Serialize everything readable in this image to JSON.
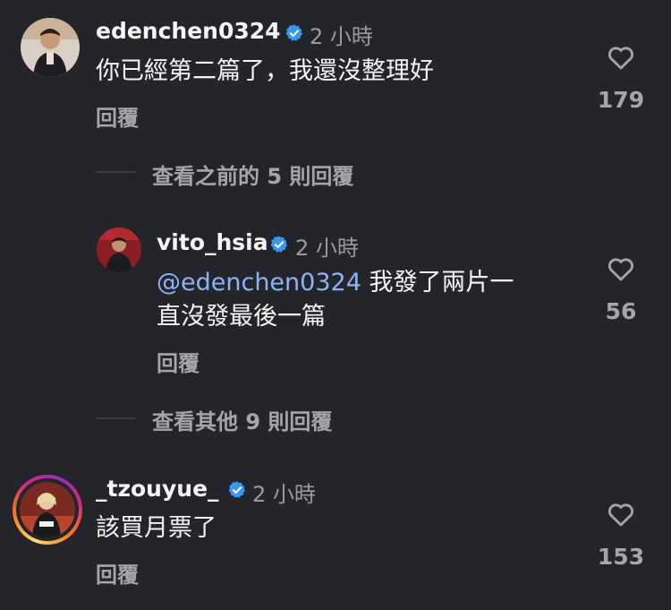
{
  "comments": [
    {
      "username": "edenchen0324",
      "time": "2 小時",
      "text": "你已經第二篇了，我還沒整理好",
      "reply_label": "回覆",
      "likes": "179"
    },
    {
      "username": "vito_hsia",
      "time": "2 小時",
      "mention": "@edenchen0324",
      "text_line1": " 我發了兩片一",
      "text_line2": "直沒發最後一篇",
      "reply_label": "回覆",
      "likes": "56"
    },
    {
      "username": "_tzouyue_",
      "time": "2 小時",
      "text": "該買月票了",
      "reply_label": "回覆",
      "likes": "153"
    }
  ],
  "view_previous": "查看之前的 5 則回覆",
  "view_more": "查看其他 9 則回覆",
  "colors": {
    "background": "#24252a",
    "verified": "#3897f0",
    "mention": "#8fb2f5",
    "muted": "#a5a6ab"
  },
  "icons": {
    "verified": "verified-badge-icon",
    "heart": "heart-outline-icon"
  }
}
